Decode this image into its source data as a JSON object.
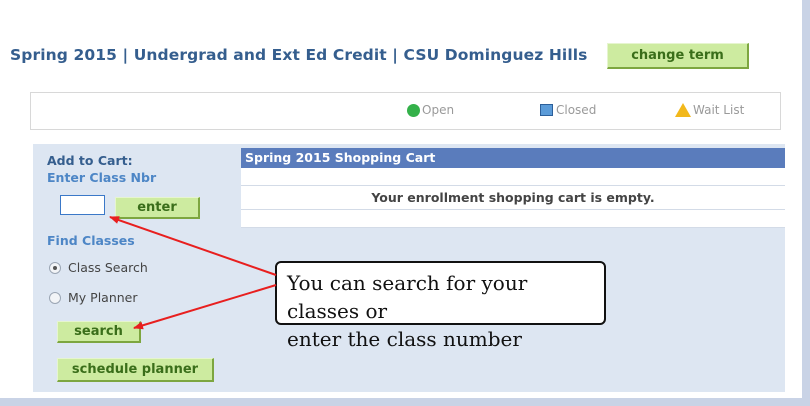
{
  "header": {
    "term_text": "Spring 2015 | Undergrad and Ext Ed Credit | CSU Dominguez Hills",
    "change_term_label": "change term"
  },
  "legend": {
    "open_label": "Open",
    "closed_label": "Closed",
    "waitlist_label": "Wait List",
    "colors": {
      "open": "#34b14a",
      "closed": "#5b9bd8",
      "waitlist": "#f2b81b"
    }
  },
  "sidebar": {
    "add_to_cart_label": "Add to Cart:",
    "enter_class_nbr_label": "Enter Class Nbr",
    "class_nbr_value": "",
    "enter_button_label": "enter",
    "find_classes_label": "Find Classes",
    "options": [
      {
        "label": "Class Search",
        "selected": true
      },
      {
        "label": "My Planner",
        "selected": false
      }
    ],
    "search_button_label": "search",
    "schedule_planner_button_label": "schedule planner"
  },
  "cart": {
    "title": "Spring 2015 Shopping Cart",
    "empty_message": "Your enrollment shopping cart is empty."
  },
  "callout": {
    "line1": "You can search for your classes or",
    "line2": "enter the class number"
  }
}
